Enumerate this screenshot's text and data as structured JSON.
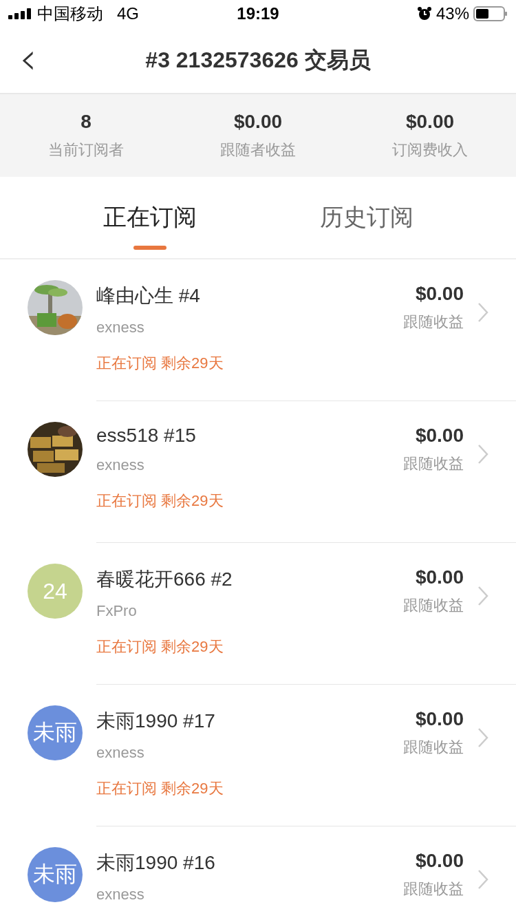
{
  "status_bar": {
    "carrier": "中国移动",
    "network": "4G",
    "time": "19:19",
    "battery": "43%"
  },
  "nav": {
    "back": "‹",
    "title": "#3 2132573626 交易员"
  },
  "stats": [
    {
      "value": "8",
      "label": "当前订阅者"
    },
    {
      "value": "$0.00",
      "label": "跟随者收益"
    },
    {
      "value": "$0.00",
      "label": "订阅费收入"
    }
  ],
  "tabs": [
    {
      "label": "正在订阅",
      "selected": true
    },
    {
      "label": "历史订阅",
      "selected": false
    }
  ],
  "subscribers": [
    {
      "name": "峰由心生 #4",
      "broker": "exness",
      "amount": "$0.00",
      "amount_label": "跟随收益",
      "status": "正在订阅 剩余29天"
    },
    {
      "name": "ess518 #15",
      "broker": "exness",
      "amount": "$0.00",
      "amount_label": "跟随收益",
      "status": "正在订阅 剩余29天"
    },
    {
      "avatar": {
        "kind": "text",
        "text": "24",
        "color": "#c5d48e"
      },
      "name": "春暖花开666 #2",
      "broker": "FxPro",
      "amount": "$0.00",
      "amount_label": "跟随收益",
      "status": "正在订阅 剩余29天"
    },
    {
      "avatar": {
        "kind": "text",
        "text": "未雨",
        "color": "#6b8fdc"
      },
      "name": "未雨1990 #17",
      "broker": "exness",
      "amount": "$0.00",
      "amount_label": "跟随收益",
      "status": "正在订阅 剩余29天"
    },
    {
      "avatar": {
        "kind": "text",
        "text": "未雨",
        "color": "#6b8fdc"
      },
      "name": "未雨1990 #16",
      "broker": "exness",
      "amount": "$0.00",
      "amount_label": "跟随收益"
    }
  ]
}
